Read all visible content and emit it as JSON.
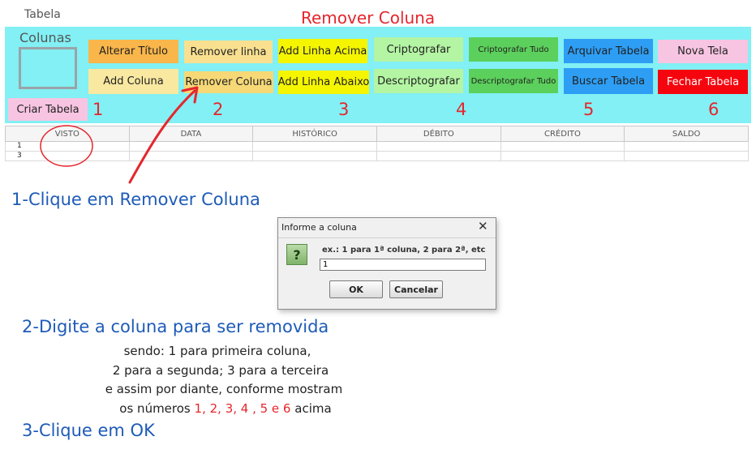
{
  "window_label": "Tabela",
  "heading": "Remover Coluna",
  "toolbar": {
    "colunas_label": "Colunas",
    "buttons": {
      "alterar_titulo": "Alterar Título",
      "add_coluna": "Add Coluna",
      "remover_linha": "Remover linha",
      "remover_coluna": "Remover Coluna",
      "add_linha_acima": "Add Linha Acima",
      "add_linha_abaixo": "Add Linha Abaixo",
      "criptografar": "Criptografar",
      "descriptografar": "Descriptografar",
      "criptografar_tudo": "Criptografar Tudo",
      "descriptografar_tudo": "Descriptografar Tudo",
      "arquivar_tabela": "Arquivar Tabela",
      "buscar_tabela": "Buscar Tabela",
      "nova_tela": "Nova Tela",
      "fechar_tabela": "Fechar Tabela",
      "criar_tabela": "Criar Tabela"
    },
    "column_numbers": [
      "1",
      "2",
      "3",
      "4",
      "5",
      "6"
    ]
  },
  "table": {
    "columns": [
      "VISTO",
      "DATA",
      "HISTÓRICO",
      "DÉBITO",
      "CRÉDITO",
      "SALDO"
    ],
    "rows": [
      "1",
      "3"
    ]
  },
  "instructions": {
    "step1": "1-Clique em Remover  Coluna",
    "step2": "2-Digite a coluna para ser removida",
    "step2_line1": "sendo: 1 para primeira coluna,",
    "step2_line2": "2 para a segunda; 3 para a terceira",
    "step2_line3": "e assim por diante, conforme mostram",
    "step2_line4_prefix": "os números",
    "step2_line4_numbers": "1, 2, 3, 4 , 5 e 6",
    "step2_line4_suffix": "acima",
    "step3": "3-Clique em OK"
  },
  "dialog": {
    "title": "Informe a coluna",
    "close_glyph": "✕",
    "icon_glyph": "?",
    "message": "ex.: 1 para 1ª coluna, 2 para 2ª, etc",
    "input_value": "1",
    "ok_label": "OK",
    "cancel_label": "Cancelar"
  },
  "colors": {
    "toolbar_bg": "#82f0f4",
    "accent_red": "#e5262d",
    "instruction_blue": "#1e5bb8",
    "orange": "#f9b64b",
    "light_yellow": "#f9e8a0",
    "yellow": "#f5f500",
    "light_green": "#b3f5a3",
    "green": "#5cd05c",
    "blue": "#2e9ef5",
    "pink": "#f7c5e2",
    "red_button": "#f5060f"
  }
}
